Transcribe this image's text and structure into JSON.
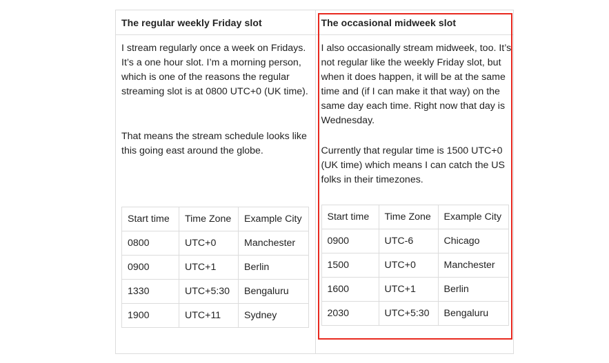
{
  "left": {
    "heading": "The regular weekly Friday slot",
    "para1": "I stream regularly once a week on Fridays. It’s a one hour slot. I’m a morning person, which is one of the reasons the regular streaming slot is at 0800 UTC+0 (UK time).",
    "para2": "That means the stream schedule looks like this going east around the globe.",
    "table": {
      "headers": [
        "Start time",
        "Time Zone",
        "Example City"
      ],
      "rows": [
        [
          "0800",
          "UTC+0",
          "Manchester"
        ],
        [
          "0900",
          "UTC+1",
          "Berlin"
        ],
        [
          "1330",
          "UTC+5:30",
          "Bengaluru"
        ],
        [
          "1900",
          "UTC+11",
          "Sydney"
        ]
      ]
    }
  },
  "right": {
    "heading": "The occasional midweek slot",
    "para1": "I also occasionally stream midweek, too. It’s not regular like the weekly Friday slot, but when it does happen, it will be at the same time and (if I can make it that way) on the same day each time. Right now that day is Wednesday.",
    "para2": "Currently that regular time is 1500 UTC+0 (UK time) which means I can catch the US folks in their timezones.",
    "table": {
      "headers": [
        "Start time",
        "Time Zone",
        "Example City"
      ],
      "rows": [
        [
          "0900",
          "UTC-6",
          "Chicago"
        ],
        [
          "1500",
          "UTC+0",
          "Manchester"
        ],
        [
          "1600",
          "UTC+1",
          "Berlin"
        ],
        [
          "2030",
          "UTC+5:30",
          "Bengaluru"
        ]
      ]
    }
  },
  "colors": {
    "highlight": "#e8281e",
    "border": "#dcdcdc"
  }
}
